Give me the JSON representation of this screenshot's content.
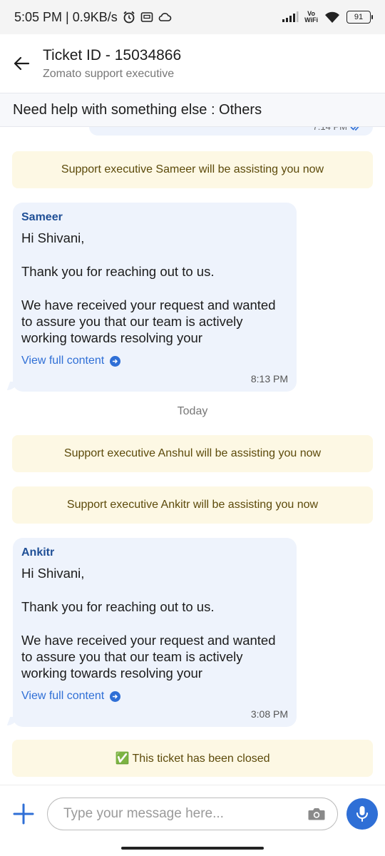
{
  "status": {
    "time_speed": "5:05 PM | 0.9KB/s",
    "vowifi_top": "Vo",
    "vowifi_bottom": "WiFi",
    "battery": "91"
  },
  "header": {
    "title": "Ticket ID - 15034866",
    "subtitle": "Zomato support executive"
  },
  "topic": "Need help with something else : Others",
  "prev_message_time": "7:14 PM",
  "messages": [
    {
      "kind": "system",
      "text": "Support executive Sameer will be assisting you now"
    },
    {
      "kind": "agent",
      "sender": "Sameer",
      "greeting": "Hi Shivani,",
      "line1": "Thank you for reaching out to us.",
      "line2": "We have received your request and wanted to assure you that our team is actively working towards resolving your",
      "view_full": "View full content",
      "time": "8:13 PM"
    },
    {
      "kind": "day",
      "text": "Today"
    },
    {
      "kind": "system",
      "text": "Support executive Anshul will be assisting you now"
    },
    {
      "kind": "system",
      "text": "Support executive Ankitr will be assisting you now"
    },
    {
      "kind": "agent",
      "sender": "Ankitr",
      "greeting": "Hi Shivani,",
      "line1": "Thank you for reaching out to us.",
      "line2": "We have received your request and wanted to assure you that our team is actively working towards resolving your",
      "view_full": "View full content",
      "time": "3:08 PM"
    },
    {
      "kind": "system",
      "text": "✅ This ticket has been closed"
    }
  ],
  "input": {
    "placeholder": "Type your message here..."
  },
  "colors": {
    "accent": "#2f6fd6",
    "bubble": "#eef3fc",
    "system_bg": "#fdf8e4",
    "sender": "#1f4f96"
  },
  "icons": [
    "back-arrow-icon",
    "alarm-icon",
    "storage-icon",
    "cloud-icon",
    "signal-icon",
    "wifi-icon",
    "battery-icon",
    "double-check-icon",
    "arrow-circle-right-icon",
    "plus-icon",
    "camera-icon",
    "microphone-icon"
  ]
}
